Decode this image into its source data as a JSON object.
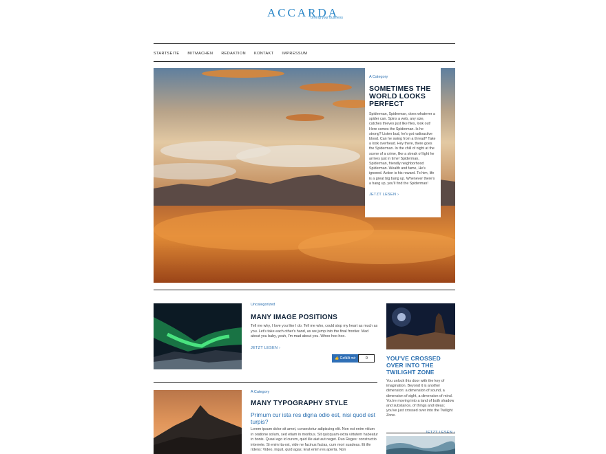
{
  "brand": {
    "name": "ACCARDA",
    "tagline": "driving your business"
  },
  "nav": [
    "STARTSEITE",
    "MITMACHEN",
    "REDAKTION",
    "KONTAKT",
    "IMPRESSUM"
  ],
  "hero": {
    "category": "A Category",
    "title": "SOMETIMES THE WORLD LOOKS PERFECT",
    "body": "Spiderman, Spiderman, does whatever a spider can. Spins a web, any size, catches thieves just like flies, look out! Here comes the Spiderman. Is he strong? Listen bud, he's got radioactive blood. Can he swing from a thread? Take a look overhead. Hey there, there goes the Spiderman. In the chill of night at the scene of a crime, like a streak of light he arrives just in time! Spiderman, Spiderman, friendly neighborhood Spiderman. Wealth and fame, He's ignored. Action is his reward. To him, life is a great big bang up. Whenever there's a hang up, you'll find the Spiderman!",
    "more": "JETZT LESEN ›"
  },
  "post1": {
    "category": "Uncategorized",
    "title": "MANY IMAGE POSITIONS",
    "body": "Tell me why, I love you like I do. Tell me who, could stop my heart as much as you. Let's take each other's hand, as we jump into the final frontier. Mad about you baby, yeah, I'm mad about you. Whoo hoo hoo.",
    "more": "JETZT LESEN ›",
    "like_label": "👍 Gefällt mir",
    "like_count": "0"
  },
  "sidebar": {
    "title": "YOU'VE CROSSED OVER INTO THE TWILIGHT ZONE",
    "body": "You unlock this door with the key of imagination. Beyond it is another dimension: a dimension of sound, a dimension of sight, a dimension of mind. You're moving into a land of both shadow and substance, of things and ideas; you've just crossed over into the Twilight Zone.",
    "more": "JETZT LESEN ›"
  },
  "post2": {
    "category": "A Category",
    "title": "MANY TYPOGRAPHY STYLE",
    "subtitle": "Primum cur ista res digna odio est, nisi quod est turpis?",
    "body": "Lorem ipsum dolor sit amet, consectetur adipiscing elit. Non est enim vitium in oratione solum, sed etiam in moribus. Sit quicquam extra virtutem habeatur in bonis. Quasi ego id curem, quid ille aiat aut neget. Duo Reges: constructio interrete. Si enim ita est, vide ne facinus facias, cum mori suadeas. Et ille ridens: Video, inquit, quid agas; Erat enim res aperta. Non"
  },
  "colors": {
    "accent": "#2a6fb0",
    "title": "#0f2238",
    "like": "#2f6fb6"
  }
}
